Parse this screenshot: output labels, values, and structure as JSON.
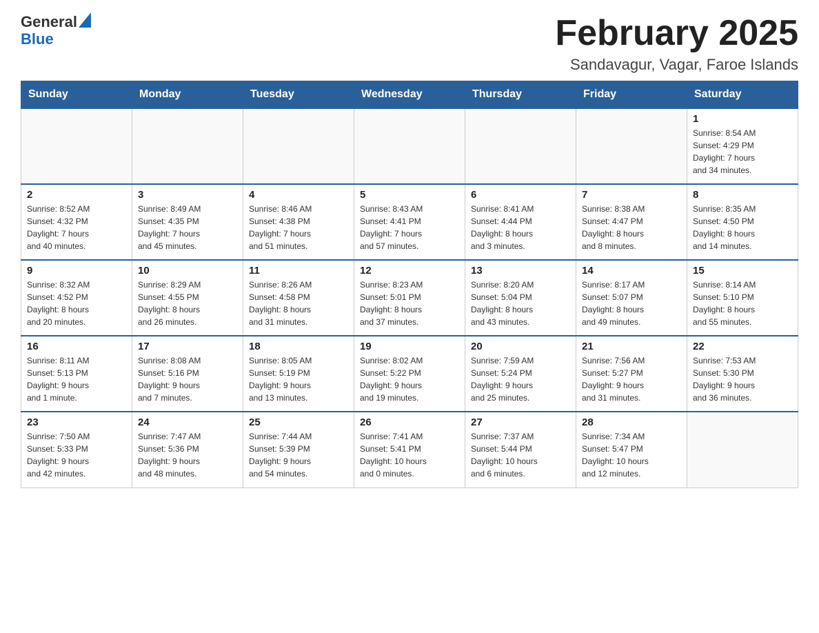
{
  "header": {
    "logo": {
      "general": "General",
      "blue": "Blue"
    },
    "title": "February 2025",
    "subtitle": "Sandavagur, Vagar, Faroe Islands"
  },
  "weekdays": [
    "Sunday",
    "Monday",
    "Tuesday",
    "Wednesday",
    "Thursday",
    "Friday",
    "Saturday"
  ],
  "weeks": [
    [
      {
        "day": "",
        "info": ""
      },
      {
        "day": "",
        "info": ""
      },
      {
        "day": "",
        "info": ""
      },
      {
        "day": "",
        "info": ""
      },
      {
        "day": "",
        "info": ""
      },
      {
        "day": "",
        "info": ""
      },
      {
        "day": "1",
        "info": "Sunrise: 8:54 AM\nSunset: 4:29 PM\nDaylight: 7 hours\nand 34 minutes."
      }
    ],
    [
      {
        "day": "2",
        "info": "Sunrise: 8:52 AM\nSunset: 4:32 PM\nDaylight: 7 hours\nand 40 minutes."
      },
      {
        "day": "3",
        "info": "Sunrise: 8:49 AM\nSunset: 4:35 PM\nDaylight: 7 hours\nand 45 minutes."
      },
      {
        "day": "4",
        "info": "Sunrise: 8:46 AM\nSunset: 4:38 PM\nDaylight: 7 hours\nand 51 minutes."
      },
      {
        "day": "5",
        "info": "Sunrise: 8:43 AM\nSunset: 4:41 PM\nDaylight: 7 hours\nand 57 minutes."
      },
      {
        "day": "6",
        "info": "Sunrise: 8:41 AM\nSunset: 4:44 PM\nDaylight: 8 hours\nand 3 minutes."
      },
      {
        "day": "7",
        "info": "Sunrise: 8:38 AM\nSunset: 4:47 PM\nDaylight: 8 hours\nand 8 minutes."
      },
      {
        "day": "8",
        "info": "Sunrise: 8:35 AM\nSunset: 4:50 PM\nDaylight: 8 hours\nand 14 minutes."
      }
    ],
    [
      {
        "day": "9",
        "info": "Sunrise: 8:32 AM\nSunset: 4:52 PM\nDaylight: 8 hours\nand 20 minutes."
      },
      {
        "day": "10",
        "info": "Sunrise: 8:29 AM\nSunset: 4:55 PM\nDaylight: 8 hours\nand 26 minutes."
      },
      {
        "day": "11",
        "info": "Sunrise: 8:26 AM\nSunset: 4:58 PM\nDaylight: 8 hours\nand 31 minutes."
      },
      {
        "day": "12",
        "info": "Sunrise: 8:23 AM\nSunset: 5:01 PM\nDaylight: 8 hours\nand 37 minutes."
      },
      {
        "day": "13",
        "info": "Sunrise: 8:20 AM\nSunset: 5:04 PM\nDaylight: 8 hours\nand 43 minutes."
      },
      {
        "day": "14",
        "info": "Sunrise: 8:17 AM\nSunset: 5:07 PM\nDaylight: 8 hours\nand 49 minutes."
      },
      {
        "day": "15",
        "info": "Sunrise: 8:14 AM\nSunset: 5:10 PM\nDaylight: 8 hours\nand 55 minutes."
      }
    ],
    [
      {
        "day": "16",
        "info": "Sunrise: 8:11 AM\nSunset: 5:13 PM\nDaylight: 9 hours\nand 1 minute."
      },
      {
        "day": "17",
        "info": "Sunrise: 8:08 AM\nSunset: 5:16 PM\nDaylight: 9 hours\nand 7 minutes."
      },
      {
        "day": "18",
        "info": "Sunrise: 8:05 AM\nSunset: 5:19 PM\nDaylight: 9 hours\nand 13 minutes."
      },
      {
        "day": "19",
        "info": "Sunrise: 8:02 AM\nSunset: 5:22 PM\nDaylight: 9 hours\nand 19 minutes."
      },
      {
        "day": "20",
        "info": "Sunrise: 7:59 AM\nSunset: 5:24 PM\nDaylight: 9 hours\nand 25 minutes."
      },
      {
        "day": "21",
        "info": "Sunrise: 7:56 AM\nSunset: 5:27 PM\nDaylight: 9 hours\nand 31 minutes."
      },
      {
        "day": "22",
        "info": "Sunrise: 7:53 AM\nSunset: 5:30 PM\nDaylight: 9 hours\nand 36 minutes."
      }
    ],
    [
      {
        "day": "23",
        "info": "Sunrise: 7:50 AM\nSunset: 5:33 PM\nDaylight: 9 hours\nand 42 minutes."
      },
      {
        "day": "24",
        "info": "Sunrise: 7:47 AM\nSunset: 5:36 PM\nDaylight: 9 hours\nand 48 minutes."
      },
      {
        "day": "25",
        "info": "Sunrise: 7:44 AM\nSunset: 5:39 PM\nDaylight: 9 hours\nand 54 minutes."
      },
      {
        "day": "26",
        "info": "Sunrise: 7:41 AM\nSunset: 5:41 PM\nDaylight: 10 hours\nand 0 minutes."
      },
      {
        "day": "27",
        "info": "Sunrise: 7:37 AM\nSunset: 5:44 PM\nDaylight: 10 hours\nand 6 minutes."
      },
      {
        "day": "28",
        "info": "Sunrise: 7:34 AM\nSunset: 5:47 PM\nDaylight: 10 hours\nand 12 minutes."
      },
      {
        "day": "",
        "info": ""
      }
    ]
  ]
}
